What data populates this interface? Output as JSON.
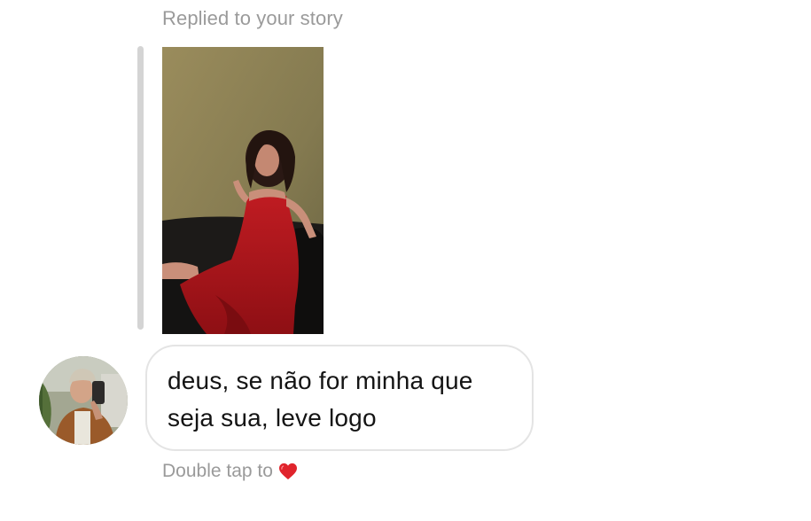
{
  "conversation": {
    "reply_context_label": "Replied to your story",
    "story_thumbnail": {
      "description_icon": "story-photo",
      "accent_color": "#b3151c"
    },
    "message": {
      "text": "deus, se não for minha que seja sua, leve logo"
    },
    "footer": {
      "hint_text": "Double tap to",
      "heart_icon": "heart-icon",
      "heart_color": "#e0242c"
    }
  }
}
